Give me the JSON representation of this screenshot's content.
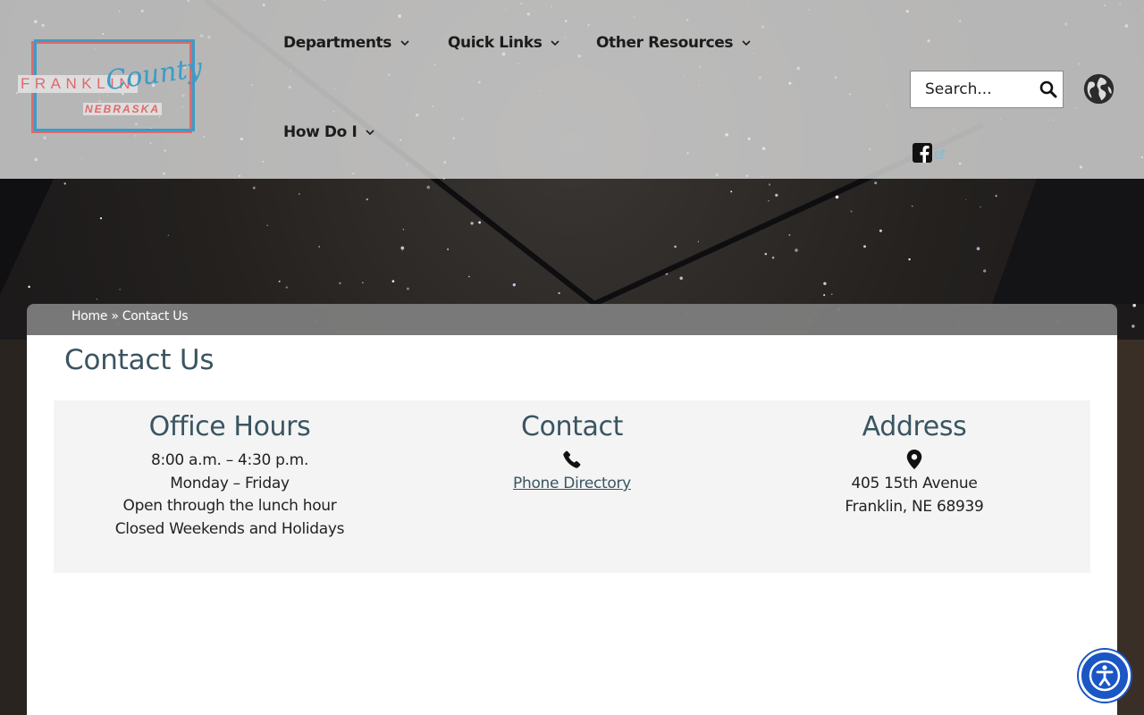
{
  "logo": {
    "word_main": "FRANKLIN",
    "word_script": "County",
    "word_sub": "NEBRASKA"
  },
  "nav": {
    "items": [
      {
        "label": "Departments"
      },
      {
        "label": "Quick Links"
      },
      {
        "label": "Other Resources"
      },
      {
        "label": "How Do I"
      }
    ]
  },
  "search": {
    "placeholder": "Search..."
  },
  "icons": {
    "search": "search-icon",
    "globe": "globe-icon",
    "facebook": "facebook-icon",
    "external": "external-link-icon",
    "phone": "phone-icon",
    "location": "location-pin-icon",
    "accessibility": "accessibility-icon"
  },
  "breadcrumb": {
    "home": "Home",
    "separator": "»",
    "current": "Contact Us"
  },
  "page": {
    "title": "Contact Us"
  },
  "office_hours": {
    "heading": "Office Hours",
    "lines": [
      "8:00 a.m. – 4:30 p.m.",
      "Monday – Friday",
      "Open through the lunch hour",
      "Closed Weekends and Holidays"
    ]
  },
  "contact": {
    "heading": "Contact",
    "link_label": "Phone Directory"
  },
  "address": {
    "heading": "Address",
    "line1": "405 15th Avenue",
    "line2": "Franklin, NE 68939"
  },
  "colors": {
    "heading": "#3a5561",
    "logo_red": "#e06969",
    "logo_blue": "#3b9cc7",
    "accessibility_blue": "#1a56c4"
  }
}
